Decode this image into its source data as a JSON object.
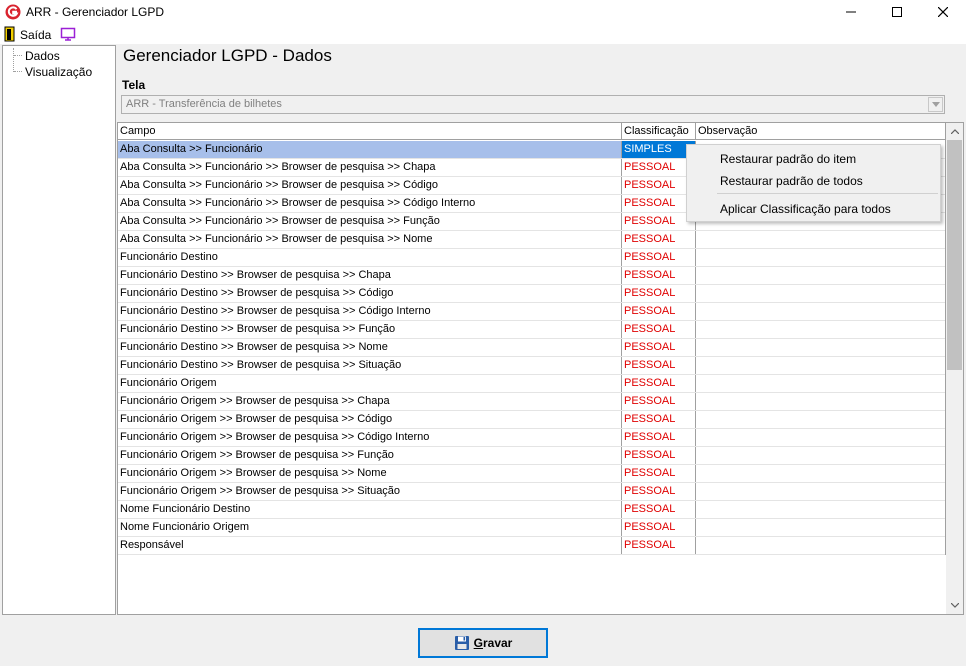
{
  "window": {
    "title": "ARR - Gerenciador LGPD"
  },
  "menu": {
    "exit_label": "Saída"
  },
  "tree": {
    "items": [
      "Dados",
      "Visualização"
    ]
  },
  "page": {
    "title": "Gerenciador LGPD - Dados",
    "tela_label": "Tela",
    "tela_value": "ARR - Transferência de bilhetes"
  },
  "grid": {
    "columns": [
      "Campo",
      "Classificação",
      "Observação"
    ],
    "rows": [
      {
        "campo": "Aba Consulta >> Funcionário",
        "class": "SIMPLES",
        "obs": ""
      },
      {
        "campo": "Aba Consulta >> Funcionário >> Browser de pesquisa >> Chapa",
        "class": "PESSOAL",
        "obs": ""
      },
      {
        "campo": "Aba Consulta >> Funcionário >> Browser de pesquisa >> Código",
        "class": "PESSOAL",
        "obs": ""
      },
      {
        "campo": "Aba Consulta >> Funcionário >> Browser de pesquisa >> Código Interno",
        "class": "PESSOAL",
        "obs": ""
      },
      {
        "campo": "Aba Consulta >> Funcionário >> Browser de pesquisa >> Função",
        "class": "PESSOAL",
        "obs": ""
      },
      {
        "campo": "Aba Consulta >> Funcionário >> Browser de pesquisa >> Nome",
        "class": "PESSOAL",
        "obs": ""
      },
      {
        "campo": "Funcionário Destino",
        "class": "PESSOAL",
        "obs": ""
      },
      {
        "campo": "Funcionário Destino >> Browser de pesquisa >> Chapa",
        "class": "PESSOAL",
        "obs": ""
      },
      {
        "campo": "Funcionário Destino >> Browser de pesquisa >> Código",
        "class": "PESSOAL",
        "obs": ""
      },
      {
        "campo": "Funcionário Destino >> Browser de pesquisa >> Código Interno",
        "class": "PESSOAL",
        "obs": ""
      },
      {
        "campo": "Funcionário Destino >> Browser de pesquisa >> Função",
        "class": "PESSOAL",
        "obs": ""
      },
      {
        "campo": "Funcionário Destino >> Browser de pesquisa >> Nome",
        "class": "PESSOAL",
        "obs": ""
      },
      {
        "campo": "Funcionário Destino >> Browser de pesquisa >> Situação",
        "class": "PESSOAL",
        "obs": ""
      },
      {
        "campo": "Funcionário Origem",
        "class": "PESSOAL",
        "obs": ""
      },
      {
        "campo": "Funcionário Origem >> Browser de pesquisa >> Chapa",
        "class": "PESSOAL",
        "obs": ""
      },
      {
        "campo": "Funcionário Origem >> Browser de pesquisa >> Código",
        "class": "PESSOAL",
        "obs": ""
      },
      {
        "campo": "Funcionário Origem >> Browser de pesquisa >> Código Interno",
        "class": "PESSOAL",
        "obs": ""
      },
      {
        "campo": "Funcionário Origem >> Browser de pesquisa >> Função",
        "class": "PESSOAL",
        "obs": ""
      },
      {
        "campo": "Funcionário Origem >> Browser de pesquisa >> Nome",
        "class": "PESSOAL",
        "obs": ""
      },
      {
        "campo": "Funcionário Origem >> Browser de pesquisa >> Situação",
        "class": "PESSOAL",
        "obs": ""
      },
      {
        "campo": "Nome Funcionário Destino",
        "class": "PESSOAL",
        "obs": ""
      },
      {
        "campo": "Nome Funcionário Origem",
        "class": "PESSOAL",
        "obs": ""
      },
      {
        "campo": "Responsável",
        "class": "PESSOAL",
        "obs": ""
      }
    ],
    "selected_index": 0
  },
  "context_menu": {
    "items": [
      "Restaurar padrão do item",
      "Restaurar padrão de todos",
      "Aplicar Classificação para todos"
    ]
  },
  "footer": {
    "save_prefix": "",
    "save_underlined": "G",
    "save_rest": "ravar"
  },
  "colors": {
    "accent": "#0078d7",
    "pessoal": "#e00000",
    "selected_row": "#a7bfea"
  }
}
